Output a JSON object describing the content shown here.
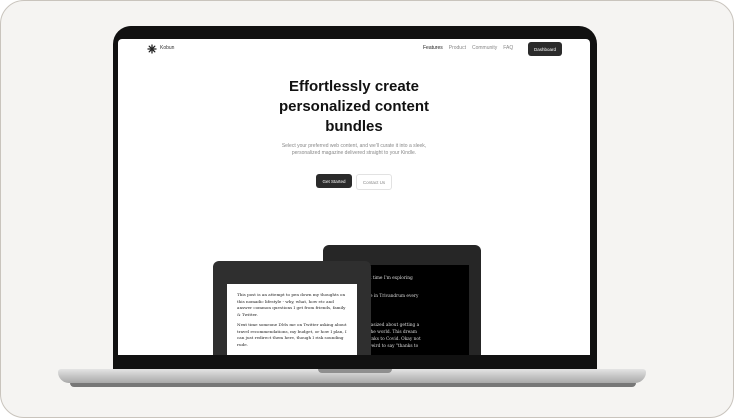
{
  "nav": {
    "brand": "Kobun",
    "links": [
      {
        "label": "Features"
      },
      {
        "label": "Product"
      },
      {
        "label": "Community"
      },
      {
        "label": "FAQ"
      }
    ],
    "cta": "Dashboard"
  },
  "hero": {
    "title": "Effortlessly create personalized content bundles",
    "subtitle": "Select your preferred web content, and we'll curate it into a sleek, personalized magazine delivered straight to your Kindle.",
    "primary_button": "Get Started",
    "secondary_button": "Contact Us"
  },
  "tablet_back": {
    "paragraphs": [
      ", this is the first time I'm exploring",
      "ly visit my home in Trivandrum every\nnths",
      "ollege, I've fantasized about getting a\nand travelling the world. This dream\nme a reality thanks to Covid. Okay not\ne feels a little weird to say \"thanks to"
    ]
  },
  "tablet_front": {
    "paragraphs": [
      "This post is an attempt to pen down my thoughts on this nomadic lifestyle - why, what, how etc and answer common questions I get from friends, family & Twitter.",
      "Next time someone DMs me on Twitter asking about travel recommendations, my budget, or how I plan, I can just redirect them here, though I risk sounding rude."
    ]
  }
}
